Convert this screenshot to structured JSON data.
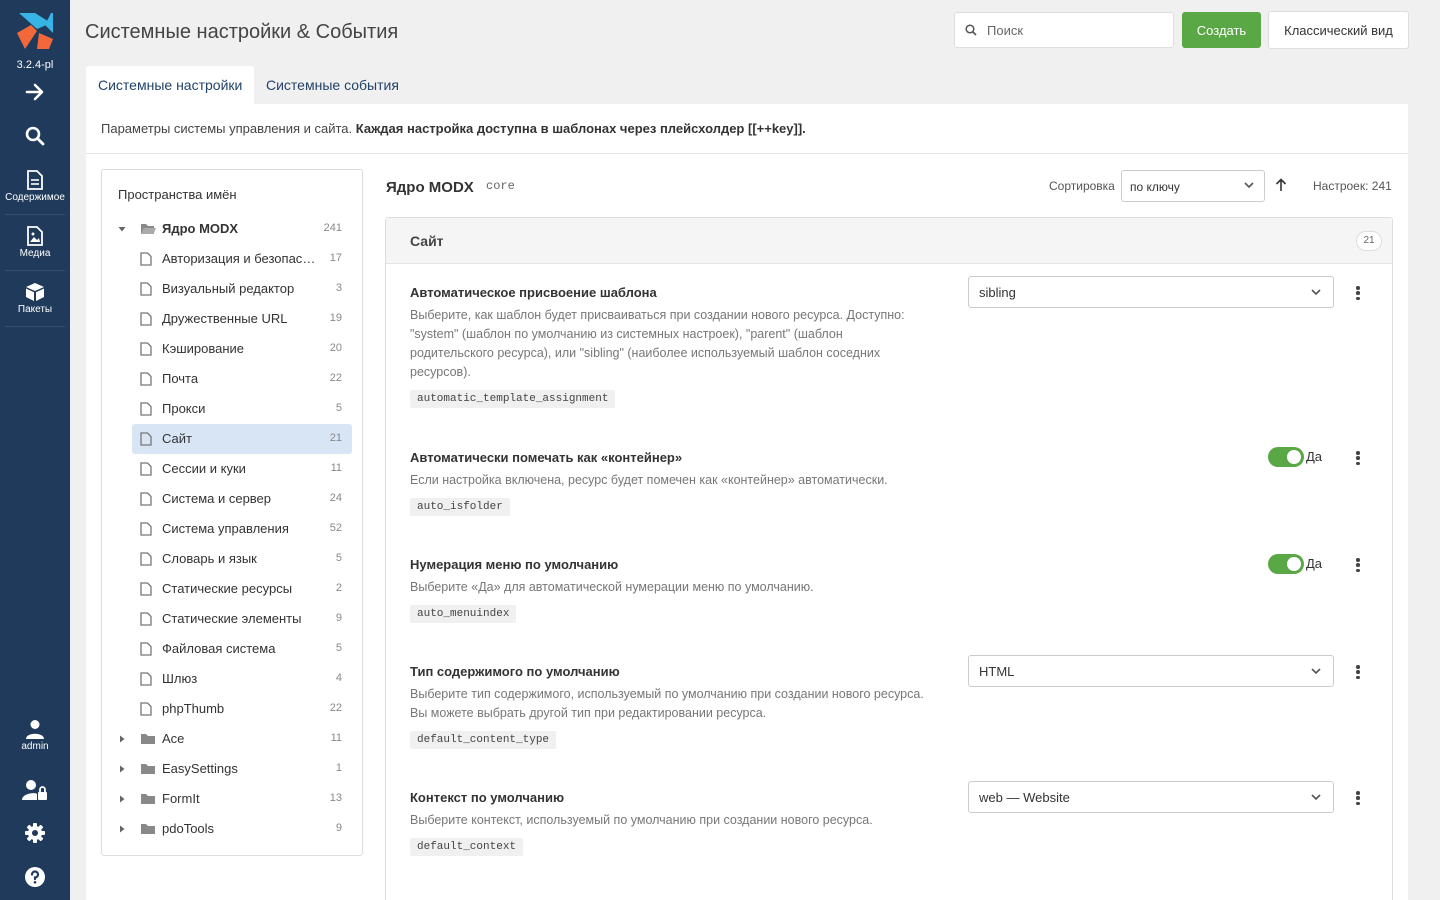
{
  "sidebar": {
    "version": "3.2.4-pl",
    "items": [
      {
        "label": "Содержимое"
      },
      {
        "label": "Медиа"
      },
      {
        "label": "Пакеты"
      },
      {
        "label": "admin"
      }
    ]
  },
  "header": {
    "title": "Системные настройки & События",
    "search_placeholder": "Поиск",
    "create_label": "Создать",
    "classic_label": "Классический вид"
  },
  "tabs": [
    {
      "label": "Системные настройки",
      "active": true
    },
    {
      "label": "Системные события",
      "active": false
    }
  ],
  "intro": {
    "text": "Параметры системы управления и сайта.",
    "bold": "Каждая настройка доступна в шаблонах через плейсхолдер [[++key]]."
  },
  "tree": {
    "heading": "Пространства имён",
    "root": {
      "label": "Ядро MODX",
      "count": "241"
    },
    "areas": [
      {
        "label": "Авторизация и безопасность",
        "count": "17"
      },
      {
        "label": "Визуальный редактор",
        "count": "3"
      },
      {
        "label": "Дружественные URL",
        "count": "19"
      },
      {
        "label": "Кэширование",
        "count": "20"
      },
      {
        "label": "Почта",
        "count": "22"
      },
      {
        "label": "Прокси",
        "count": "5"
      },
      {
        "label": "Сайт",
        "count": "21"
      },
      {
        "label": "Сессии и куки",
        "count": "11"
      },
      {
        "label": "Система и сервер",
        "count": "24"
      },
      {
        "label": "Система управления",
        "count": "52"
      },
      {
        "label": "Словарь и язык",
        "count": "5"
      },
      {
        "label": "Статические ресурсы",
        "count": "2"
      },
      {
        "label": "Статические элементы",
        "count": "9"
      },
      {
        "label": "Файловая система",
        "count": "5"
      },
      {
        "label": "Шлюз",
        "count": "4"
      },
      {
        "label": "phpThumb",
        "count": "22"
      }
    ],
    "namespaces": [
      {
        "label": "Ace",
        "count": "11"
      },
      {
        "label": "EasySettings",
        "count": "1"
      },
      {
        "label": "FormIt",
        "count": "13"
      },
      {
        "label": "pdoTools",
        "count": "9"
      }
    ]
  },
  "content": {
    "ns_title": "Ядро MODX",
    "ns_key": "core",
    "sort_label": "Сортировка",
    "sort_value": "по ключу",
    "count_label": "Настроек: 241",
    "area_title": "Сайт",
    "area_count": "21",
    "settings": [
      {
        "name": "Автоматическое присвоение шаблона",
        "desc": "Выберите, как шаблон будет присваиваться при создании нового ресурса. Доступно: \"system\" (шаблон по умолчанию из системных настроек), \"parent\" (шаблон родительского ресурса), или \"sibling\" (наиболее используемый шаблон соседних ресурсов).",
        "key": "automatic_template_assignment",
        "control": "select",
        "value": "sibling"
      },
      {
        "name": "Автоматически помечать как «контейнер»",
        "desc": "Если настройка включена, ресурс будет помечен как «контейнер» автоматически.",
        "key": "auto_isfolder",
        "control": "toggle",
        "value": "Да"
      },
      {
        "name": "Нумерация меню по умолчанию",
        "desc": "Выберите «Да» для автоматической нумерации меню по умолчанию.",
        "key": "auto_menuindex",
        "control": "toggle",
        "value": "Да"
      },
      {
        "name": "Тип содержимого по умолчанию",
        "desc": "Выберите тип содержимого, используемый по умолчанию при создании нового ресурса. Вы можете выбрать другой тип при редактировании ресурса.",
        "key": "default_content_type",
        "control": "select",
        "value": "HTML"
      },
      {
        "name": "Контекст по умолчанию",
        "desc": "Выберите контекст, используемый по умолчанию при создании нового ресурса.",
        "key": "default_context",
        "control": "select",
        "value": "web — Website"
      }
    ]
  },
  "colors": {
    "sidebar": "#1f3a5a",
    "accent_green": "#5aa745",
    "selected_row": "#d7e5f5",
    "logo_blue": "#37b3e6",
    "logo_orange": "#f2683a"
  }
}
